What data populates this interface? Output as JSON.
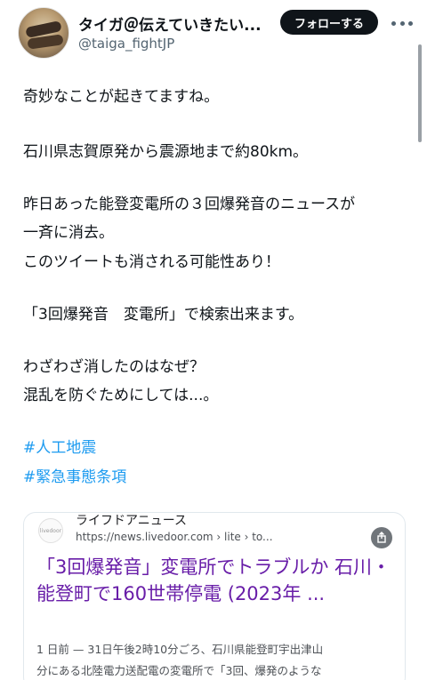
{
  "header": {
    "display_name": "タイガ＠伝えていきたい...",
    "handle": "@taiga_fightJP",
    "follow_label": "フォローする"
  },
  "tweet": {
    "lines": [
      "奇妙なことが起きてますね。",
      "石川県志賀原発から震源地まで約80km。",
      "昨日あった能登変電所の３回爆発音のニュースが",
      "一斉に消去。",
      "このツイートも消される可能性あり！",
      "「3回爆発音　変電所」で検索出来ます。",
      "わざわざ消したのはなぜ？",
      "混乱を防ぐためにしては...。"
    ],
    "hashtags": [
      "#人工地震",
      "#緊急事態条項"
    ]
  },
  "card": {
    "logo_text": "livedoor",
    "source": "ライフドアニュース",
    "url": "https://news.livedoor.com › lite › to...",
    "title": "「3回爆発音」変電所でトラブルか 石川・能登町で160世帯停電 (2023年 ...",
    "snippet_lines": [
      "1 日前 — 31日午後2時10分ごろ、石川県能登町宇出津山",
      "分にある北陸電力送配電の変電所で「3回、爆発のような"
    ]
  },
  "colors": {
    "link_blue": "#1d9bf0",
    "title_purple": "#681da8",
    "follow_bg": "#0f1419"
  }
}
